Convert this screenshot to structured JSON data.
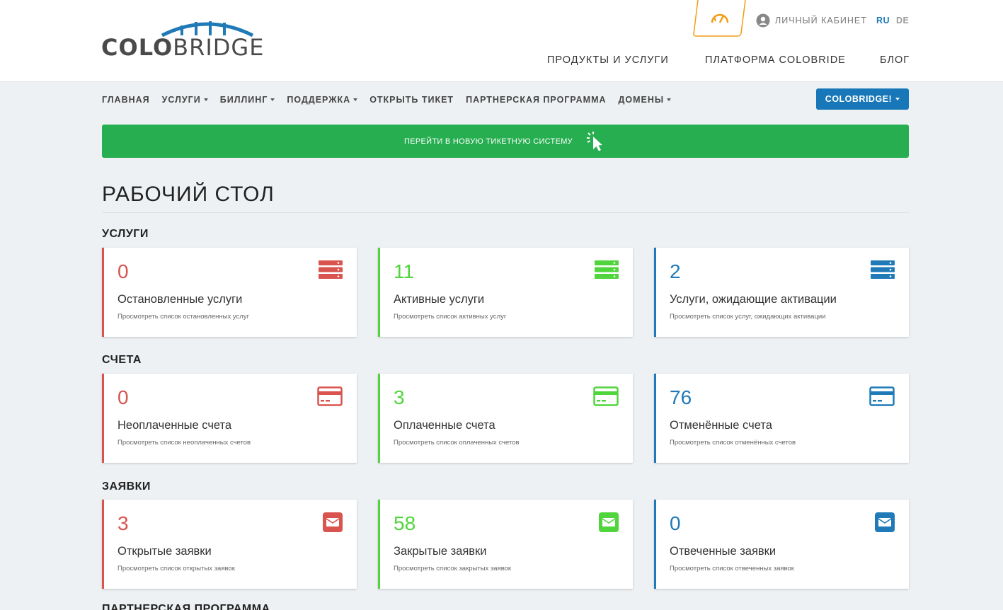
{
  "colors": {
    "red": "#d9534f",
    "green": "#50d53c",
    "blue": "#1f7ab7",
    "primary": "#1877b8",
    "banner": "#27ae50"
  },
  "logo": {
    "bold": "COLO",
    "light": "BRIDGE"
  },
  "topbar": {
    "account_label": "ЛИЧНЫЙ КАБИНЕТ",
    "lang_ru": "RU",
    "lang_de": "DE"
  },
  "main_nav": {
    "products": "ПРОДУКТЫ И УСЛУГИ",
    "platform": "ПЛАТФОРМА COLOBRIDE",
    "blog": "БЛОГ"
  },
  "subnav": {
    "home": "ГЛАВНАЯ",
    "services": "УСЛУГИ",
    "billing": "БИЛЛИНГ",
    "support": "ПОДДЕРЖКА",
    "open_ticket": "ОТКРЫТЬ ТИКЕТ",
    "partner": "ПАРТНЕРСКАЯ ПРОГРАММА",
    "domains": "ДОМЕНЫ",
    "account_button": "COLOBRIDGE!"
  },
  "banner": {
    "text": "ПЕРЕЙТИ В НОВУЮ ТИКЕТНУЮ СИСТЕМУ"
  },
  "page_title": "РАБОЧИЙ СТОЛ",
  "sections": [
    {
      "title": "УСЛУГИ",
      "icon": "server-icon",
      "cards": [
        {
          "value": "0",
          "label": "Остановленные услуги",
          "sub": "Просмотреть список остановленных услуг",
          "color": "red"
        },
        {
          "value": "11",
          "label": "Активные услуги",
          "sub": "Просмотреть список активных услуг",
          "color": "green"
        },
        {
          "value": "2",
          "label": "Услуги, ожидающие активации",
          "sub": "Просмотреть список услуг, ожидающих активации",
          "color": "blue"
        }
      ]
    },
    {
      "title": "СЧЕТА",
      "icon": "credit-card-icon",
      "cards": [
        {
          "value": "0",
          "label": "Неоплаченные счета",
          "sub": "Просмотреть список неоплаченных счетов",
          "color": "red"
        },
        {
          "value": "3",
          "label": "Оплаченные счета",
          "sub": "Просмотреть список оплаченных счетов",
          "color": "green"
        },
        {
          "value": "76",
          "label": "Отменённые счета",
          "sub": "Просмотреть список отменённых счетов",
          "color": "blue"
        }
      ]
    },
    {
      "title": "ЗАЯВКИ",
      "icon": "envelope-icon",
      "cards": [
        {
          "value": "3",
          "label": "Открытые заявки",
          "sub": "Просмотреть список открытых заявок",
          "color": "red"
        },
        {
          "value": "58",
          "label": "Закрытые заявки",
          "sub": "Просмотреть список закрытых заявок",
          "color": "green"
        },
        {
          "value": "0",
          "label": "Отвеченные заявки",
          "sub": "Просмотреть список отвеченных заявок",
          "color": "blue"
        }
      ]
    }
  ],
  "next_section_title": "ПАРТНЕРСКАЯ ПРОГРАММА"
}
